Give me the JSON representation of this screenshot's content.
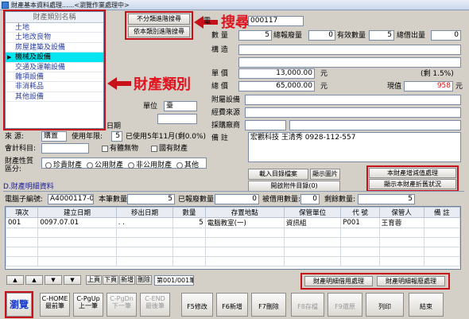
{
  "window": {
    "title": "財產基本資料處理......<瀏覽作業處理中>"
  },
  "category_list": {
    "header": "財產類別名稱",
    "items": [
      "土地",
      "土地改良物",
      "房屋建築及設備",
      "機械及設備",
      "交通及運輸設備",
      "雜項設備",
      "非消耗品",
      "其他設備"
    ],
    "selected_index": 3
  },
  "search_buttons": {
    "fuzzy": "不分類進階搜尋",
    "category": "依本類別進階搜尋"
  },
  "annotations": {
    "search": "搜尋",
    "category": "財產類別"
  },
  "top_fields": {
    "code_label": "電",
    "code_value": "000117",
    "qty_label": "數 量",
    "qty_value": "5",
    "total_lost_label": "總報廢量",
    "total_lost_value": "0",
    "valid_qty_label": "有效數量",
    "valid_qty_value": "5",
    "total_borrow_label": "總借出量",
    "total_borrow_value": "0",
    "spec_label": "構 造"
  },
  "price": {
    "unit_price_label": "單 價",
    "unit_price_value": "13,000.00",
    "unit_price_unit": "元",
    "total_label": "總 價",
    "total_value": "65,000.00",
    "total_unit": "元",
    "rate_label": "(剩 1.5%)",
    "current_label": "現值",
    "current_value": "958",
    "current_unit": "元"
  },
  "middle_labels": {
    "accessory": "附屬設備",
    "fund_source": "經費來源",
    "vendor": "採購廠商",
    "remark_label": "備 註",
    "remark_value": "宏觀科技 王清秀 0928-112-557",
    "unit_label": "單位",
    "unit_value": "臺",
    "date_label": "日期"
  },
  "left_fields": {
    "source_label": "來 源:",
    "source_value": "購置",
    "life_label": "使用年限:",
    "life_value": "5",
    "life_note": "已使用5年11月(剩0.0%)",
    "account_label": "會計科目:",
    "intangible": "有體無物",
    "state_owned": "國有財產",
    "nature_label": "財產性質區分:",
    "nature_options": [
      "珍貴財產",
      "公用財產",
      "非公用財產",
      "其他"
    ]
  },
  "side_buttons": {
    "load_catalog": "載入目錄檔案",
    "show_image": "顯示圖片",
    "open_attach": "開啟附件目錄(0)",
    "add_depr": "本財產增減值處理",
    "show_depr": "顯示本財產折舊狀況"
  },
  "detail": {
    "section_title": "D.財產明細資料",
    "code_label": "電腦子編號:",
    "code_value": "A4000117-001",
    "qty_label": "本筆數量:",
    "qty_value": "5",
    "lost_label": "已報廢數量:",
    "lost_value": "0",
    "borrow_label": "被借用數量:",
    "borrow_value": "0",
    "remain_label": "剩餘數量:",
    "remain_value": "5",
    "columns": [
      "項次",
      "建立日期",
      "移出日期",
      "數量",
      "存置地點",
      "保管單位",
      "代 號",
      "保管人",
      "備 註"
    ],
    "rows": [
      [
        "001",
        "0097.07.01",
        ". .",
        "5",
        "電腦教室(一)",
        "資訊組",
        "P001",
        "王育蓉",
        ""
      ]
    ]
  },
  "nav": {
    "buttons": [
      "上頁",
      "下頁",
      "新增",
      "刪除"
    ],
    "page_indicator": "第001/001筆",
    "borrow_btn": "財產明細借用處理",
    "lost_btn": "財產明細報廢處理"
  },
  "toolbar": [
    {
      "label": "瀏覽",
      "sub": "",
      "disabled": false
    },
    {
      "label": "C-HOME",
      "sub": "最前筆",
      "disabled": false
    },
    {
      "label": "C-PgUp",
      "sub": "上一筆",
      "disabled": false
    },
    {
      "label": "C-PgDn",
      "sub": "下一筆",
      "disabled": true
    },
    {
      "label": "C-END",
      "sub": "最後筆",
      "disabled": true
    },
    {
      "label": "F5修改",
      "sub": "",
      "disabled": false
    },
    {
      "label": "F6新增",
      "sub": "",
      "disabled": false
    },
    {
      "label": "F7刪除",
      "sub": "",
      "disabled": false
    },
    {
      "label": "F8存檔",
      "sub": "",
      "disabled": true
    },
    {
      "label": "F9還原",
      "sub": "",
      "disabled": true
    },
    {
      "label": "列印",
      "sub": "",
      "disabled": false
    },
    {
      "label": "結束",
      "sub": "",
      "disabled": false
    }
  ],
  "colors": {
    "accent": "#c8101a",
    "selection": "#00e5f0",
    "link": "#2a3fa0"
  }
}
